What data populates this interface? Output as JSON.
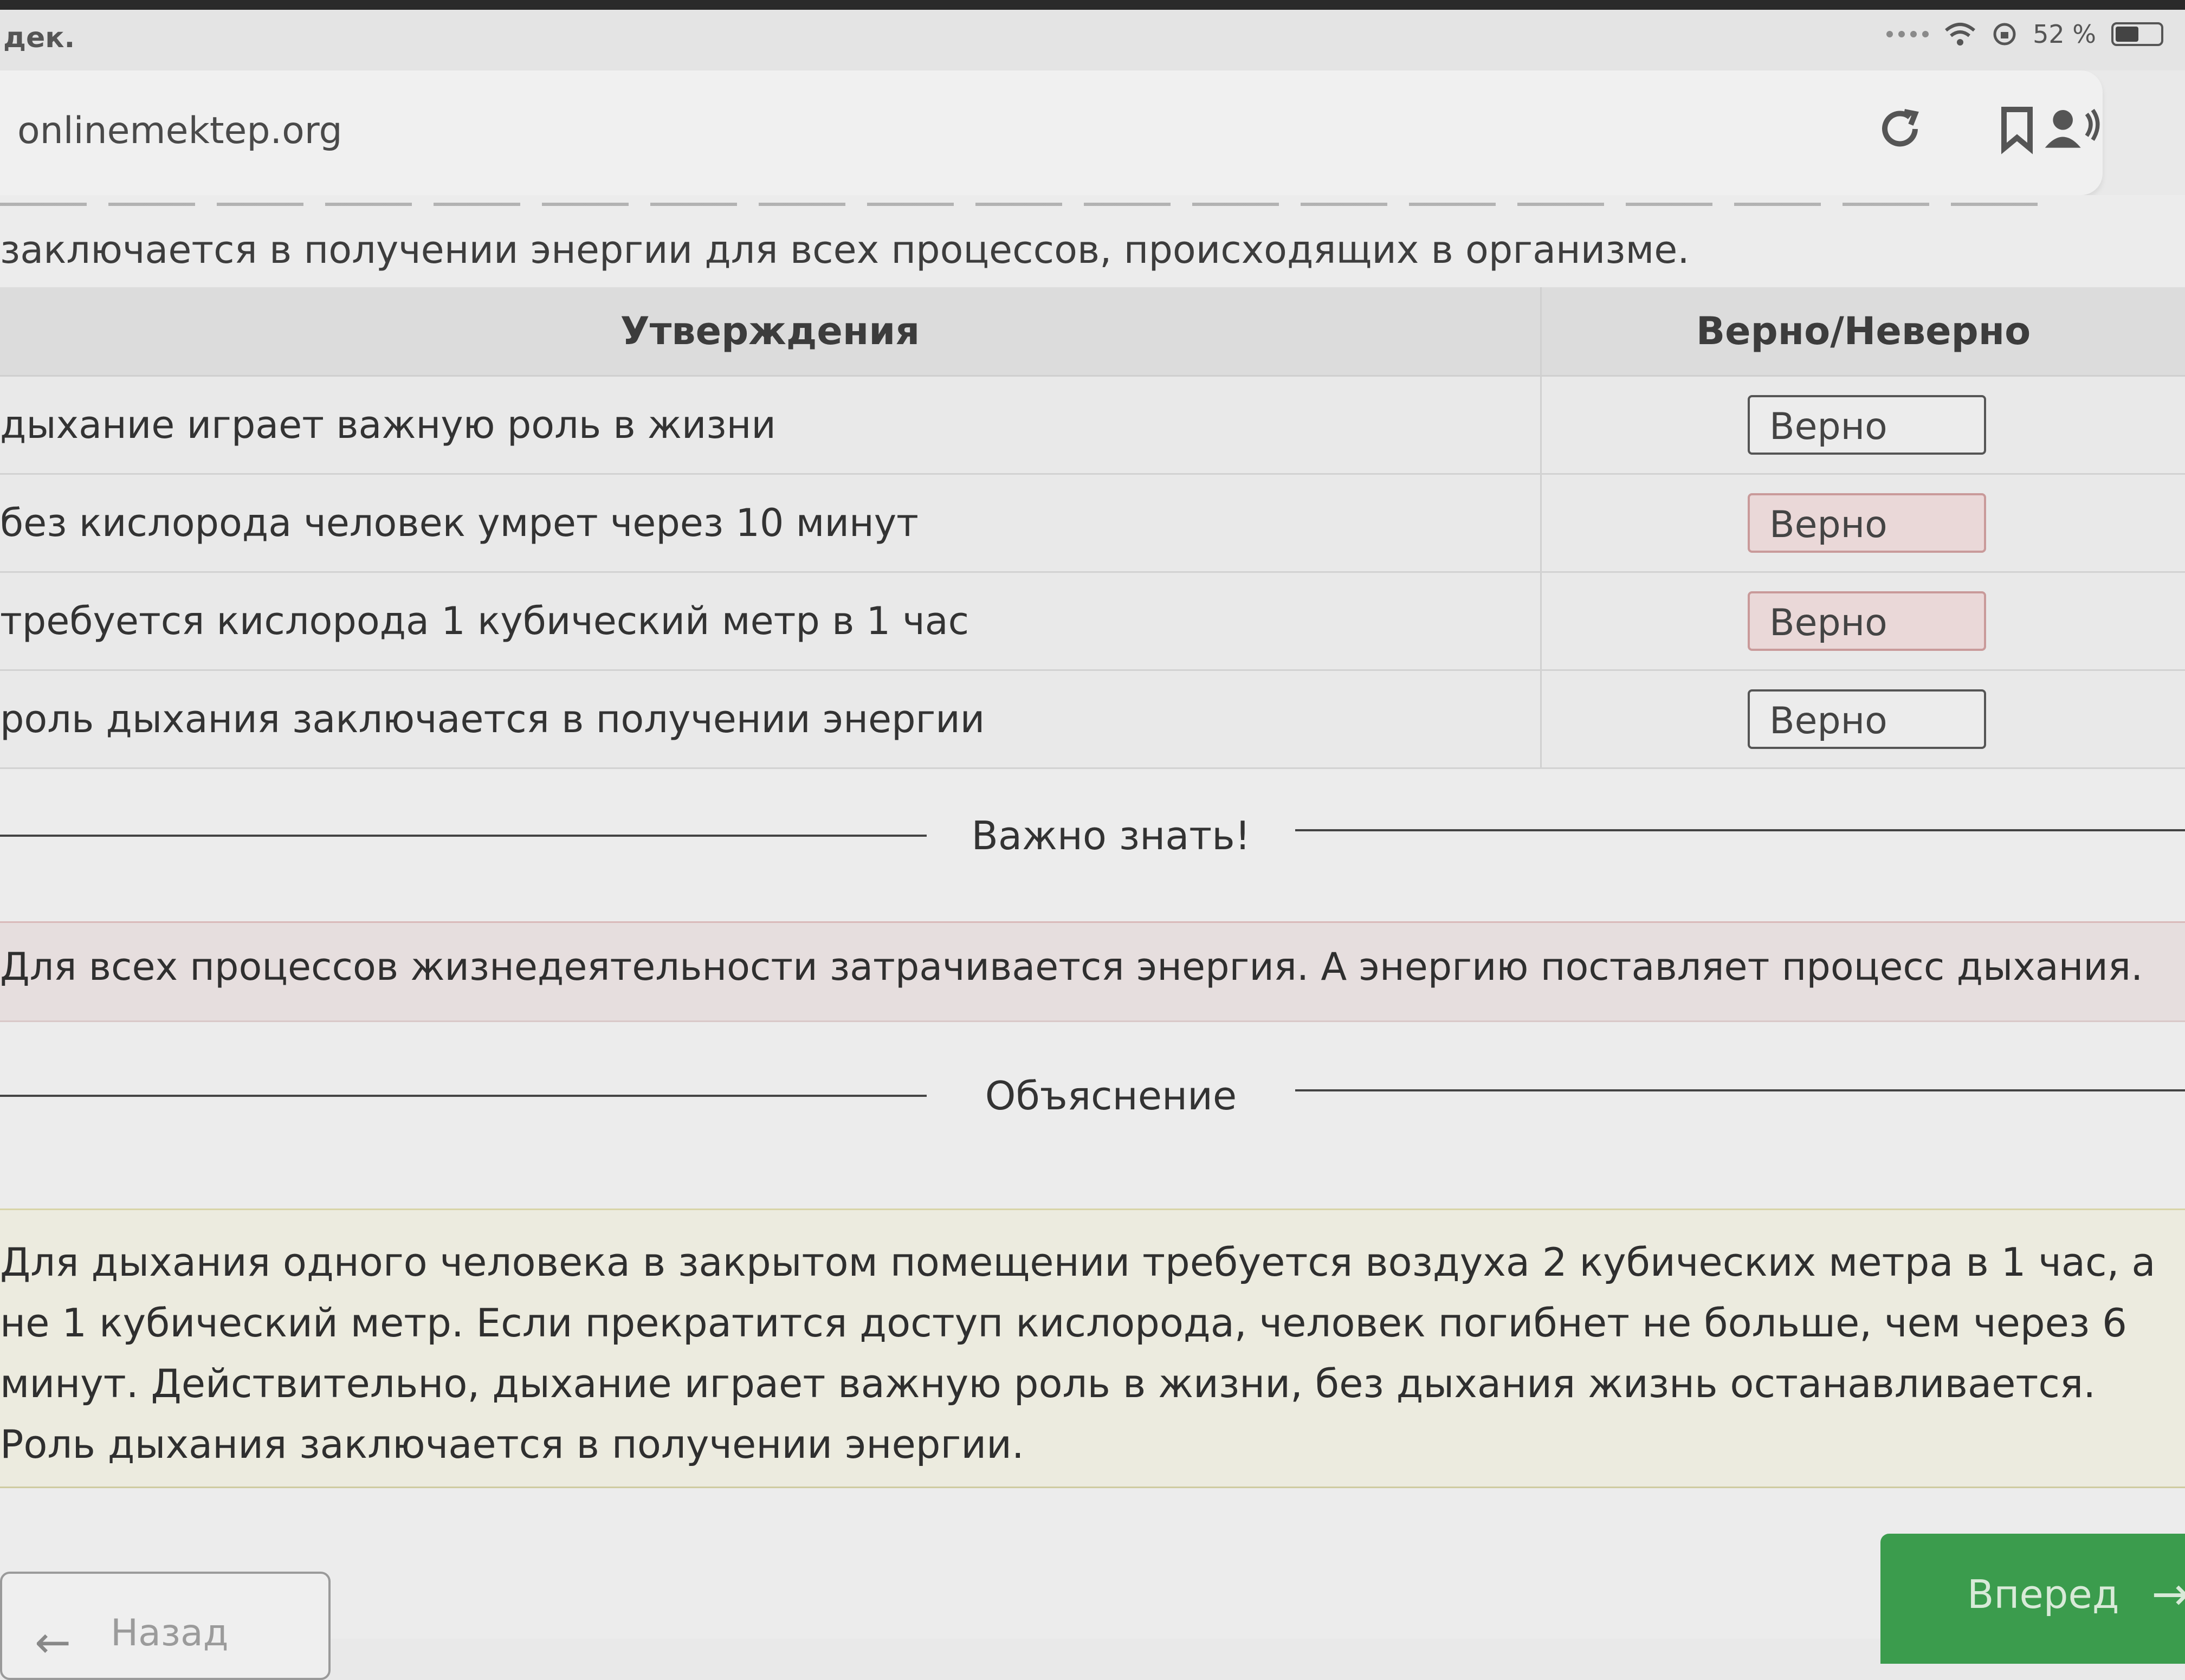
{
  "status_bar": {
    "time": "дек.",
    "battery": "52 %",
    "battery_level": 0.52
  },
  "browser": {
    "url": "onlinemektep.org",
    "icons": [
      "reload-icon",
      "bookmark-icon",
      "profile-icon"
    ]
  },
  "intro": {
    "text": "заключается в получении энергии для всех процессов, происходящих в организме."
  },
  "table": {
    "headers": [
      "Утверждения",
      "Верно/Неверно"
    ],
    "rows": [
      {
        "statement": "дыхание играет важную роль в жизни",
        "answer": "Верно"
      },
      {
        "statement": "без кислорода человек умрет через 10 минут",
        "answer": "Верно"
      },
      {
        "statement": "требуется кислорода 1 кубический метр в 1 час",
        "answer": "Верно"
      },
      {
        "statement": "роль дыхания заключается в получении энергии",
        "answer": "Верно"
      }
    ]
  },
  "important": {
    "title": "Важно знать!",
    "text": "Для всех процессов жизнедеятельности затрачивается энергия. А энергию поставляет процесс дыхания."
  },
  "explanation": {
    "title": "Объяснение",
    "text": "Для дыхания одного человека в закрытом помещении требуется воздуха 2 кубических метра в 1 час, а не 1 кубический метр. Если прекратится доступ кислорода, человек погибнет не больше, чем через 6 минут. Действительно, дыхание играет важную роль в жизни, без дыхания жизнь останавливается. Роль дыхания заключается в получении энергии."
  },
  "navigation": {
    "back_label": "Назад",
    "forward_label": "Вперед"
  }
}
